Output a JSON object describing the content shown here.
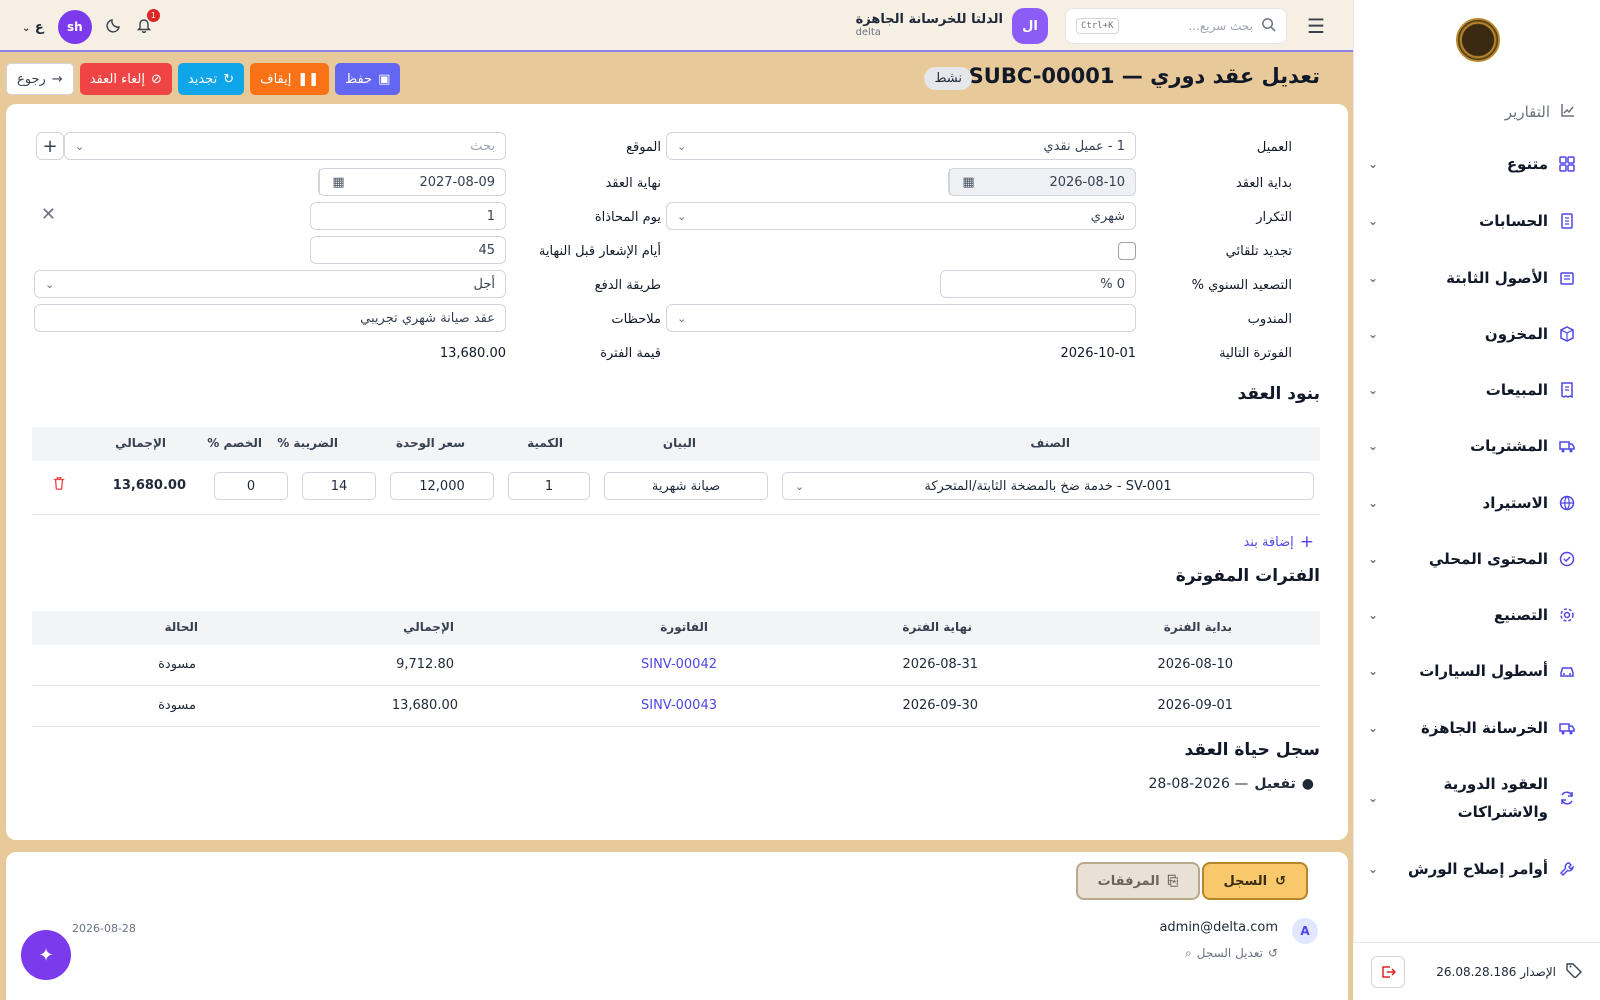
{
  "topbar": {
    "search_placeholder": "بحث سريع...",
    "search_shortcut": "Ctrl+K",
    "company_initials": "ال",
    "company_name": "الدلتا للخرسانة الجاهزة",
    "company_code": "delta",
    "user_initials": "sh",
    "notifications_count": "1",
    "lang_label": "ع"
  },
  "sidebar": {
    "reports": "التقارير",
    "items": [
      {
        "label": "متنوع"
      },
      {
        "label": "الحسابات"
      },
      {
        "label": "الأصول الثابتة"
      },
      {
        "label": "المخزون"
      },
      {
        "label": "المبيعات"
      },
      {
        "label": "المشتريات"
      },
      {
        "label": "الاستيراد"
      },
      {
        "label": "المحتوى المحلي"
      },
      {
        "label": "التصنيع"
      },
      {
        "label": "أسطول السيارات"
      },
      {
        "label": "الخرسانة الجاهزة"
      },
      {
        "label_line1": "العقود الدورية",
        "label_line2": "والاشتراكات"
      },
      {
        "label": "أوامر إصلاح الورش"
      }
    ],
    "version": "الإصدار 26.08.28.186"
  },
  "header": {
    "title": "تعديل عقد دوري — SUBC-00001",
    "status": "نشط",
    "save": "حفظ",
    "pause": "إيقاف",
    "renew": "تجديد",
    "cancel": "إلغاء العقد",
    "back": "رجوع"
  },
  "form": {
    "customer_label": "العميل",
    "customer_value": "1 - عميل نقدي",
    "location_label": "الموقع",
    "location_placeholder": "بحث",
    "start_label": "بداية العقد",
    "start_value": "2026-08-10",
    "end_label": "نهاية العقد",
    "end_value": "2027-08-09",
    "frequency_label": "التكرار",
    "frequency_value": "شهري",
    "billing_day_label": "يوم المحاذاة",
    "billing_day_value": "1",
    "auto_renew_label": "تجديد تلقائي",
    "notice_days_label": "أيام الإشعار قبل النهاية",
    "notice_days_value": "45",
    "escalation_label": "التصعيد السنوي %",
    "escalation_value": "0 %",
    "payment_label": "طريقة الدفع",
    "payment_value": "أجل",
    "rep_label": "المندوب",
    "rep_value": "",
    "notes_label": "ملاحظات",
    "notes_value": "عقد صيانة شهري تجريبي",
    "next_invoice_label": "الفوترة التالية",
    "next_invoice_value": "2026-10-01",
    "period_value_label": "قيمة الفترة",
    "period_value": "13,680.00"
  },
  "lines": {
    "title": "بنود العقد",
    "headers": {
      "item": "الصنف",
      "desc": "البيان",
      "qty": "الكمية",
      "price": "سعر الوحدة",
      "tax": "الضريبة %",
      "discount": "الخصم %",
      "total": "الإجمالي"
    },
    "rows": [
      {
        "item": "SV-001 - خدمة ضخ بالمضخة الثابتة/المتحركة",
        "desc": "صيانة شهرية",
        "qty": "1",
        "price": "12,000",
        "tax": "14",
        "discount": "0",
        "total": "13,680.00"
      }
    ],
    "add_label": "إضافة بند"
  },
  "periods": {
    "title": "الفترات المفوترة",
    "headers": {
      "start": "بداية الفترة",
      "end": "نهاية الفترة",
      "invoice": "الفاتورة",
      "total": "الإجمالي",
      "status": "الحالة"
    },
    "rows": [
      {
        "start": "2026-08-10",
        "end": "2026-08-31",
        "invoice": "SINV-00042",
        "total": "9,712.80",
        "status": "مسودة"
      },
      {
        "start": "2026-09-01",
        "end": "2026-09-30",
        "invoice": "SINV-00043",
        "total": "13,680.00",
        "status": "مسودة"
      }
    ]
  },
  "lifecycle": {
    "title": "سجل حياة العقد",
    "entry_action": "تفعيل",
    "entry_date": "— 28-08-2026"
  },
  "bottom": {
    "tab_log": "السجل",
    "tab_attachments": "المرفقات",
    "user_initial": "A",
    "user_email": "admin@delta.com",
    "log_action": "تعديل السجل",
    "log_date": "2026-08-28"
  },
  "colors": {
    "accent": "#6366f1",
    "danger": "#ef4444",
    "info": "#0ea5e9",
    "warning": "#f97316"
  }
}
